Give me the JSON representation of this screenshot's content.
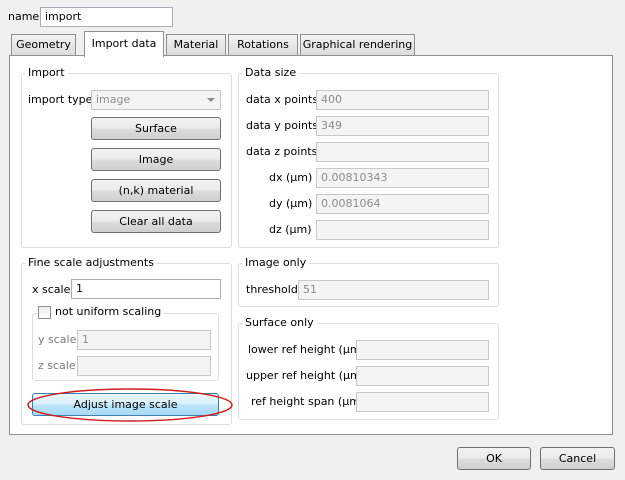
{
  "name_field": {
    "label": "name",
    "value": "import"
  },
  "tabs": [
    {
      "label": "Geometry"
    },
    {
      "label": "Import data"
    },
    {
      "label": "Material"
    },
    {
      "label": "Rotations"
    },
    {
      "label": "Graphical rendering"
    }
  ],
  "import_group": {
    "title": "Import",
    "import_type_label": "import type",
    "import_type_value": "image",
    "buttons": {
      "surface": "Surface",
      "image": "Image",
      "nk_material": "(n,k) material",
      "clear": "Clear all data"
    }
  },
  "data_size_group": {
    "title": "Data size",
    "rows": [
      {
        "label": "data x points",
        "value": "400"
      },
      {
        "label": "data y points",
        "value": "349"
      },
      {
        "label": "data z points",
        "value": ""
      },
      {
        "label": "dx (µm)",
        "value": "0.00810343"
      },
      {
        "label": "dy (µm)",
        "value": "0.0081064"
      },
      {
        "label": "dz (µm)",
        "value": ""
      }
    ]
  },
  "fine_scale_group": {
    "title": "Fine scale adjustments",
    "x_scale_label": "x scale",
    "x_scale_value": "1",
    "not_uniform_label": "not uniform scaling",
    "y_scale_label": "y scale",
    "y_scale_value": "1",
    "z_scale_label": "z scale",
    "z_scale_value": "",
    "adjust_button": "Adjust image scale"
  },
  "image_only_group": {
    "title": "Image only",
    "threshold_label": "threshold",
    "threshold_value": "51"
  },
  "surface_only_group": {
    "title": "Surface only",
    "rows": [
      {
        "label": "lower ref height (µm)",
        "value": ""
      },
      {
        "label": "upper ref height (µm)",
        "value": ""
      },
      {
        "label": "ref height span (µm)",
        "value": ""
      }
    ]
  },
  "footer": {
    "ok": "OK",
    "cancel": "Cancel"
  },
  "colors": {
    "highlight_ring": "#cc2020",
    "hot_button": "#bee6fd"
  }
}
